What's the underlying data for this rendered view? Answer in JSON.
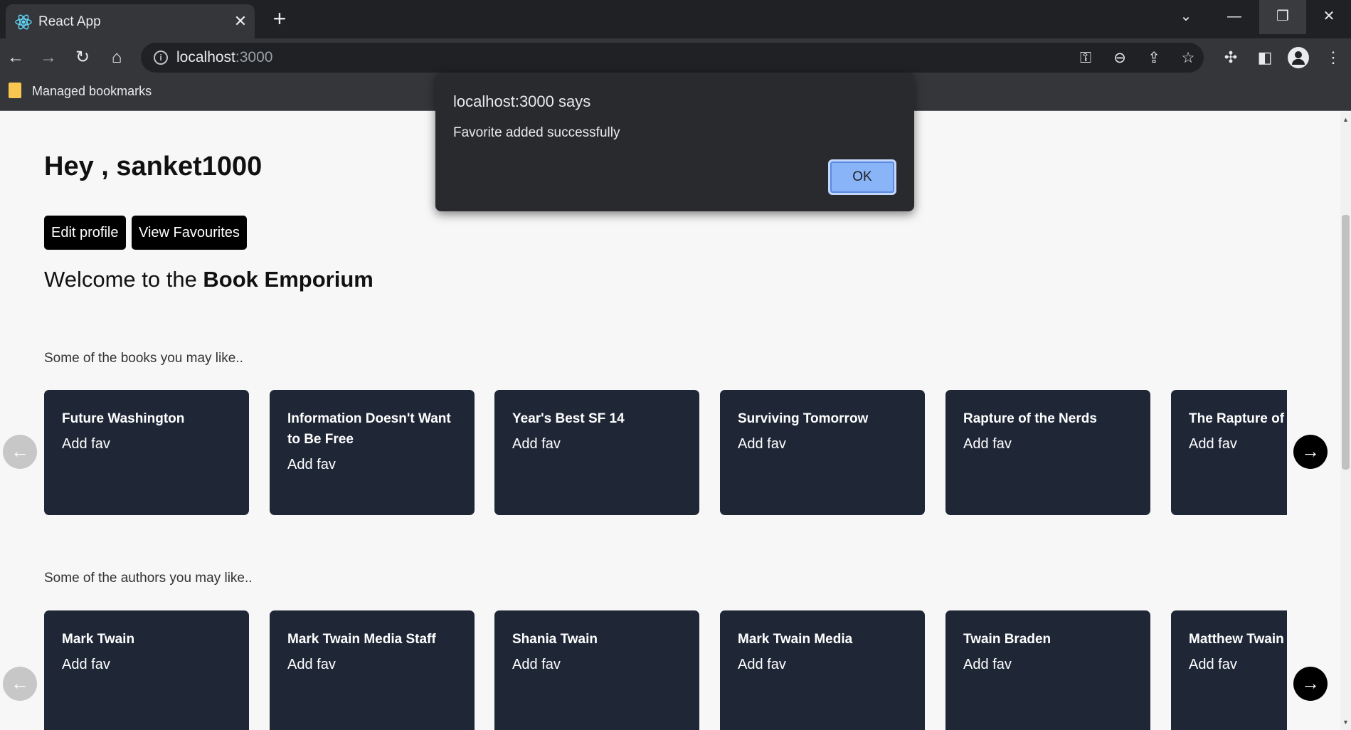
{
  "browser": {
    "tab_title": "React App",
    "tab_close": "✕",
    "new_tab": "+",
    "url_host": "localhost",
    "url_port": ":3000",
    "bookmarks_label": "Managed bookmarks"
  },
  "dialog": {
    "title": "localhost:3000 says",
    "message": "Favorite added successfully",
    "ok_label": "OK"
  },
  "page": {
    "greeting": "Hey , sanket1000",
    "edit_profile": "Edit profile",
    "view_favourites": "View Favourites",
    "welcome_prefix": "Welcome to the ",
    "welcome_brand": "Book Emporium",
    "books_label": "Some of the books you may like..",
    "authors_label": "Some of the authors you may like.."
  },
  "books": [
    {
      "title": "Future Washington",
      "fav": "Add fav"
    },
    {
      "title": "Information Doesn't Want to Be Free",
      "fav": "Add fav"
    },
    {
      "title": "Year's Best SF 14",
      "fav": "Add fav"
    },
    {
      "title": "Surviving Tomorrow",
      "fav": "Add fav"
    },
    {
      "title": "Rapture of the Nerds",
      "fav": "Add fav"
    },
    {
      "title": "The Rapture of the Nerds",
      "fav": "Add fav"
    }
  ],
  "authors": [
    {
      "title": "Mark Twain",
      "fav": "Add fav"
    },
    {
      "title": "Mark Twain Media Staff",
      "fav": "Add fav"
    },
    {
      "title": "Shania Twain",
      "fav": "Add fav"
    },
    {
      "title": "Mark Twain Media",
      "fav": "Add fav"
    },
    {
      "title": "Twain Braden",
      "fav": "Add fav"
    },
    {
      "title": "Matthew Twain",
      "fav": "Add fav"
    }
  ],
  "icons": {
    "prev_arrow": "←",
    "next_arrow": "→"
  }
}
